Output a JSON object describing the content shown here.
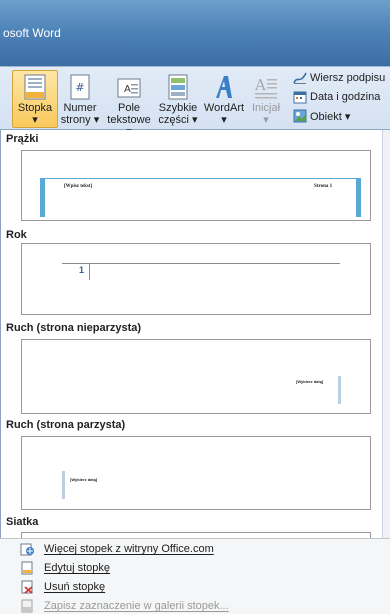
{
  "window": {
    "title": "osoft Word"
  },
  "ribbon": {
    "buttons": [
      {
        "label1": "Stopka",
        "label2": "▾"
      },
      {
        "label1": "Numer",
        "label2": "strony ▾"
      },
      {
        "label1": "Pole",
        "label2": "tekstowe ▾"
      },
      {
        "label1": "Szybkie",
        "label2": "części ▾"
      },
      {
        "label1": "WordArt",
        "label2": "▾"
      },
      {
        "label1": "Inicjał",
        "label2": "▾"
      }
    ],
    "small_buttons": [
      {
        "label": "Wiersz podpisu"
      },
      {
        "label": "Data i godzina"
      },
      {
        "label": "Obiekt ▾"
      }
    ]
  },
  "gallery": {
    "sections": [
      {
        "title": "Prążki",
        "left_text": "[Wpisz tekst]",
        "right_text": "Strona 1"
      },
      {
        "title": "Rok",
        "page_number": "1"
      },
      {
        "title": "Ruch (strona nieparzysta)",
        "date_text": "[Wybierz datę]"
      },
      {
        "title": "Ruch (strona parzysta)",
        "date_text": "[Wybierz datę]"
      },
      {
        "title": "Siatka"
      }
    ]
  },
  "menu": {
    "items": [
      {
        "label": "Więcej stopek z witryny Office.com"
      },
      {
        "label": "Edytuj stopkę"
      },
      {
        "label": "Usuń stopkę"
      },
      {
        "label": "Zapisz zaznaczenie w galerii stopek..."
      }
    ]
  }
}
